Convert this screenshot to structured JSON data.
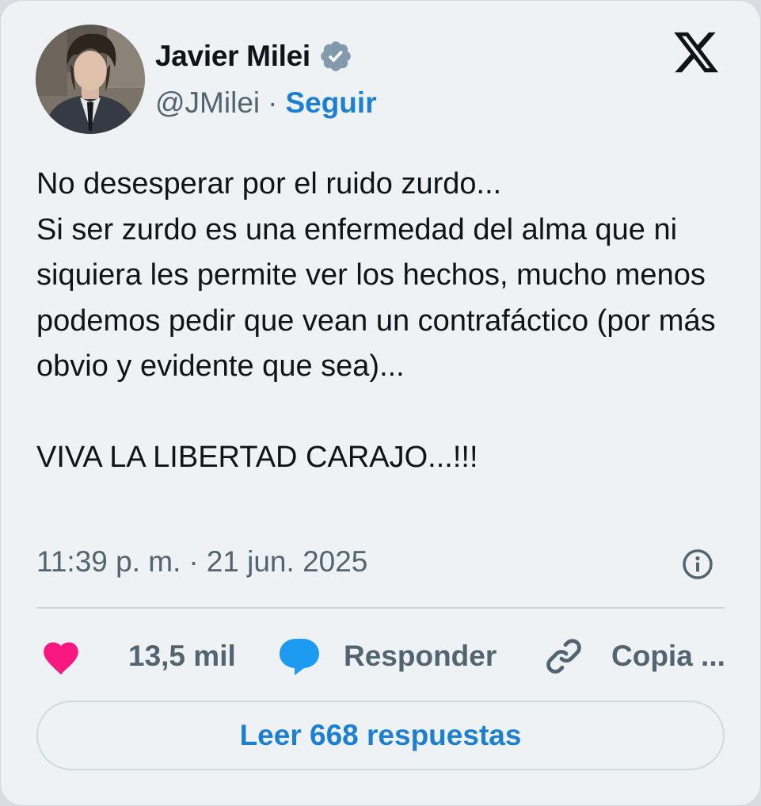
{
  "author": {
    "name": "Javier Milei",
    "handle": "@JMilei",
    "separator": "·",
    "follow_label": "Seguir",
    "verified_icon": "verified-badge-icon"
  },
  "brand": {
    "logo": "x-logo-icon"
  },
  "tweet": {
    "text": "No desesperar por el ruido zurdo...\nSi ser zurdo es una enfermedad del alma que ni siquiera les permite ver los hechos, mucho menos podemos pedir que vean un contrafáctico (por más obvio y evidente que sea)...\n\nVIVA LA LIBERTAD CARAJO...!!!",
    "time": "11:39 p. m.",
    "separator": "·",
    "date": "21 jun. 2025"
  },
  "actions": {
    "like": {
      "icon": "heart-icon",
      "label": "13,5 mil"
    },
    "reply": {
      "icon": "speech-bubble-icon",
      "label": "Responder"
    },
    "copy": {
      "icon": "link-icon",
      "label": "Copia ..."
    }
  },
  "read_replies": {
    "label": "Leer 668 respuestas"
  },
  "colors": {
    "background": "#eef2f5",
    "text": "#0f1419",
    "secondary": "#536471",
    "link": "#1d7fcf",
    "like": "#f91880",
    "reply": "#1d9bf0",
    "verified": "#829aab"
  }
}
